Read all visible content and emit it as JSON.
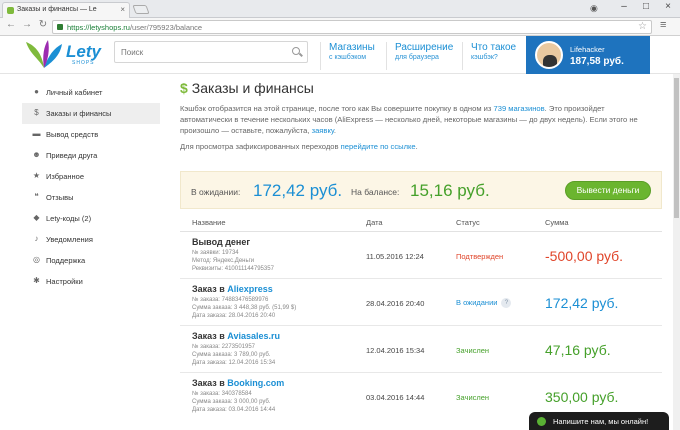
{
  "browser": {
    "tab_title": "Заказы и финансы — Le",
    "tab_close": "×",
    "url_domain": "https://letyshops.ru",
    "url_path": "/user/795923/balance"
  },
  "header": {
    "logo_text": "Lety",
    "logo_sub": "SHOPS",
    "search_placeholder": "Поиск",
    "nav": [
      {
        "title": "Магазины",
        "sub": "с кэшбэком"
      },
      {
        "title": "Расширение",
        "sub": "для браузера"
      },
      {
        "title": "Что такое",
        "sub": "кэшбэк?"
      }
    ],
    "user": {
      "name": "Lifehacker",
      "balance": "187,58 руб."
    }
  },
  "sidebar": {
    "items": [
      {
        "label": "Личный кабинет",
        "icon": "user-icon"
      },
      {
        "label": "Заказы и финансы",
        "icon": "dollar-icon"
      },
      {
        "label": "Вывод средств",
        "icon": "card-icon"
      },
      {
        "label": "Приведи друга",
        "icon": "friends-icon"
      },
      {
        "label": "Избранное",
        "icon": "star-icon"
      },
      {
        "label": "Отзывы",
        "icon": "comments-icon"
      },
      {
        "label": "Lety-коды (2)",
        "icon": "tag-icon"
      },
      {
        "label": "Уведомления",
        "icon": "bell-icon"
      },
      {
        "label": "Поддержка",
        "icon": "lifebuoy-icon"
      },
      {
        "label": "Настройки",
        "icon": "gear-icon"
      }
    ]
  },
  "main": {
    "title_symbol": "$",
    "title": "Заказы и финансы",
    "intro_1": "Кэшбэк отобразится на этой странице, после того как Вы совершите покупку в одном из ",
    "intro_link": "739 магазинов",
    "intro_2": ". Это произойдет автоматически в течение нескольких часов (AliExpress — несколько дней, некоторые магазины — до двух недель). Если этого не произошло — оставьте, пожалуйста, ",
    "intro_link2": "заявку",
    "intro_3": ".",
    "note": "Для просмотра зафиксированных переходов ",
    "note_link": "перейдите по ссылке",
    "note_end": ".",
    "pending_label": "В ожидании:",
    "pending_value": "172,42 руб.",
    "balance_label": "На балансе:",
    "balance_value": "15,16 руб.",
    "withdraw_button": "Вывести деньги",
    "columns": [
      "Название",
      "Дата",
      "Статус",
      "Сумма"
    ],
    "rows": [
      {
        "title_prefix": "Вывод денег",
        "store": "",
        "lines": [
          "№ заявки: 19734",
          "Метод: Яндекс.Деньги",
          "Реквизиты: 410011144795357"
        ],
        "date": "11.05.2016 12:24",
        "status": "Подтвержден",
        "sum": "-500,00 руб."
      },
      {
        "title_prefix": "Заказ в ",
        "store": "Aliexpress",
        "lines": [
          "№ заказа: 74883476589976",
          "Сумма заказа: 3 448,38 руб. (51,99 $)",
          "Дата заказа: 28.04.2016 20:40"
        ],
        "date": "28.04.2016 20:40",
        "status": "В ожидании",
        "status_help": "?",
        "sum": "172,42 руб."
      },
      {
        "title_prefix": "Заказ в ",
        "store": "Aviasales.ru",
        "lines": [
          "№ заказа: 2273501957",
          "Сумма заказа: 3 789,00 руб.",
          "Дата заказа: 12.04.2016 15:34"
        ],
        "date": "12.04.2016 15:34",
        "status": "Зачислен",
        "sum": "47,16 руб."
      },
      {
        "title_prefix": "Заказ в ",
        "store": "Booking.com",
        "lines": [
          "№ заказа: 340378584",
          "Сумма заказа: 3 000,00 руб.",
          "Дата заказа: 03.04.2016 14:44"
        ],
        "date": "03.04.2016 14:44",
        "status": "Зачислен",
        "sum": "350,00 руб."
      }
    ]
  },
  "chat": {
    "label": "Напишите нам, мы онлайн!"
  },
  "colors": {
    "brand_blue": "#1b8fd4",
    "accent_green": "#6bb52f",
    "status_confirmed": "#e0452a",
    "status_pending": "#1b8fd4",
    "status_credited": "#45a02a",
    "sum_negative": "#e0452a",
    "sum_pending": "#1b8fd4",
    "sum_credited": "#45a02a"
  }
}
